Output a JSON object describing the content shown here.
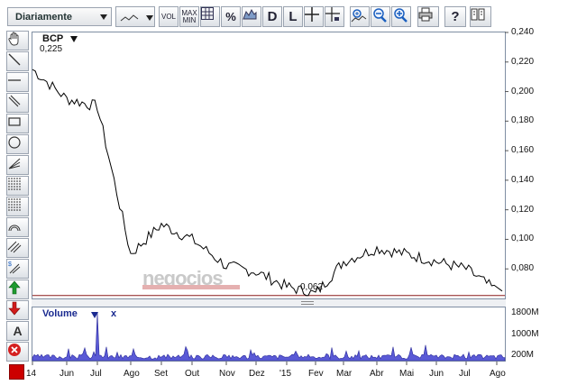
{
  "toolbar": {
    "period": "Diariamente",
    "vol_label": "VOL",
    "maxmin_label_1": "MAX",
    "maxmin_label_2": "MIN",
    "percent_label": "%",
    "d_label": "D",
    "l_label": "L",
    "help_label": "?"
  },
  "tools": {
    "text_tool_label": "A"
  },
  "price_chart": {
    "ticker": "BCP",
    "last_value": "0,225",
    "min_annotation": "0,062",
    "watermark": "negocios",
    "line_color": "#000000",
    "reference_line_color": "#8b1a1a",
    "y_ticks": [
      "0,240",
      "0,220",
      "0,200",
      "0,180",
      "0,160",
      "0,140",
      "0,120",
      "0,100",
      "0,080"
    ]
  },
  "volume_chart": {
    "title": "Volume",
    "close_label": "x",
    "fill_color": "#5a5ad6",
    "y_ticks": [
      "1800M",
      "1000M",
      "200M"
    ]
  },
  "x_axis": {
    "ticks": [
      "14",
      "Jun",
      "Jul",
      "Ago",
      "Set",
      "Out",
      "Nov",
      "Dez",
      "'15",
      "Fev",
      "Mar",
      "Abr",
      "Mai",
      "Jun",
      "Jul",
      "Ago"
    ]
  },
  "chart_data": {
    "type": "line",
    "x": [
      "14",
      "Jun",
      "Jul",
      "Ago",
      "Set",
      "Out",
      "Nov",
      "Dez",
      "'15",
      "Fev",
      "Mar",
      "Abr",
      "Mai",
      "Jun",
      "Jul",
      "Ago"
    ],
    "series": [
      {
        "values": [
          0.215,
          0.195,
          0.19,
          0.09,
          0.11,
          0.1,
          0.082,
          0.078,
          0.068,
          0.063,
          0.085,
          0.094,
          0.09,
          0.085,
          0.08,
          0.065
        ]
      }
    ],
    "reference_line": 0.062,
    "ylim": [
      0.06,
      0.24
    ],
    "volume": {
      "ylim": [
        0,
        2000
      ],
      "spike_month": "Jul",
      "spike_value": 1800
    }
  }
}
